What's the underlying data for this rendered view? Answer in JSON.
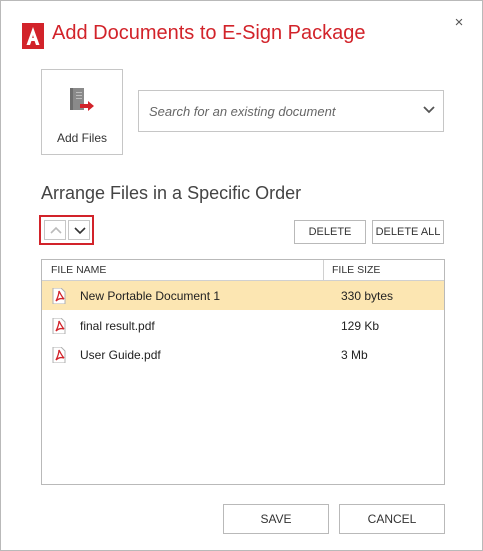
{
  "dialog": {
    "title": "Add Documents to E-Sign Package",
    "close_symbol": "×",
    "title_icon": "acrobat-logo-icon"
  },
  "add_files": {
    "label": "Add Files",
    "icon": "add-file-icon"
  },
  "search": {
    "placeholder": "Search for an existing document",
    "icon": "chevron-down-icon"
  },
  "arrange": {
    "title": "Arrange Files in a Specific Order",
    "move_up_icon": "chevron-up-icon",
    "move_down_icon": "chevron-down-icon",
    "delete_label": "DELETE",
    "delete_all_label": "DELETE ALL"
  },
  "files": {
    "headers": {
      "name": "FILE NAME",
      "size": "FILE SIZE"
    },
    "rows": [
      {
        "name": "New Portable Document 1",
        "size": "330 bytes",
        "selected": true,
        "icon": "pdf-icon"
      },
      {
        "name": "final result.pdf",
        "size": "129 Kb",
        "selected": false,
        "icon": "pdf-icon"
      },
      {
        "name": "User Guide.pdf",
        "size": "3 Mb",
        "selected": false,
        "icon": "pdf-icon"
      }
    ]
  },
  "footer": {
    "save_label": "SAVE",
    "cancel_label": "CANCEL"
  },
  "colors": {
    "accent": "#d2232a",
    "selected_row": "#fce6b2",
    "border": "#b9b9b9"
  }
}
